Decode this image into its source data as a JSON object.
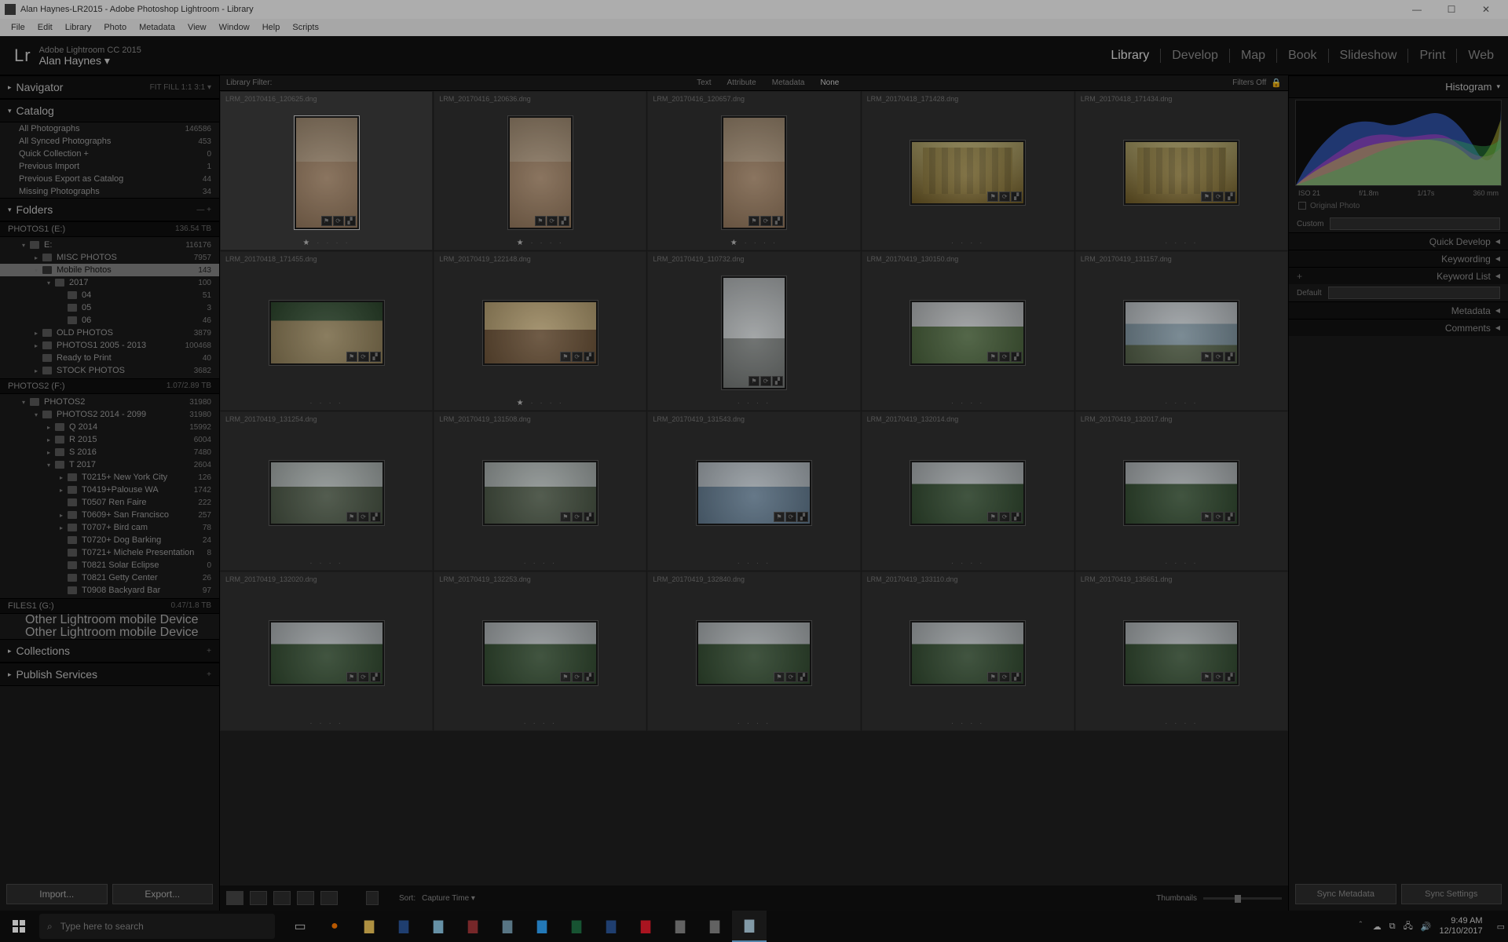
{
  "window": {
    "title": "Alan Haynes-LR2015 - Adobe Photoshop Lightroom - Library",
    "min": "—",
    "max": "☐",
    "close": "✕"
  },
  "menu": [
    "File",
    "Edit",
    "Library",
    "Photo",
    "Metadata",
    "View",
    "Window",
    "Help",
    "Scripts"
  ],
  "identity": {
    "product": "Adobe Lightroom CC 2015",
    "user": "Alan Haynes  ▾",
    "logo": "Lr"
  },
  "modules": [
    "Library",
    "Develop",
    "Map",
    "Book",
    "Slideshow",
    "Print",
    "Web"
  ],
  "active_module": "Library",
  "left": {
    "navigator": {
      "title": "Navigator",
      "extras": "FIT   FILL   1:1   3:1  ▾"
    },
    "catalog": {
      "title": "Catalog",
      "rows": [
        {
          "label": "All Photographs",
          "count": "146586"
        },
        {
          "label": "All Synced Photographs",
          "count": "453"
        },
        {
          "label": "Quick Collection  +",
          "count": "0"
        },
        {
          "label": "Previous Import",
          "count": "1"
        },
        {
          "label": "Previous Export as Catalog",
          "count": "44"
        },
        {
          "label": "Missing Photographs",
          "count": "34"
        }
      ]
    },
    "folders": {
      "title": "Folders",
      "volumes": [
        {
          "name": "PHOTOS1 (E:)",
          "info": "136.54 TB"
        }
      ],
      "tree": [
        {
          "tw": "▾",
          "d": 1,
          "label": "E:",
          "count": "116176"
        },
        {
          "tw": "▸",
          "d": 2,
          "label": "MISC PHOTOS",
          "count": "7957"
        },
        {
          "tw": "▾",
          "d": 2,
          "label": "Mobile Photos",
          "count": "143",
          "sel": true
        },
        {
          "tw": "▾",
          "d": 3,
          "label": "2017",
          "count": "100"
        },
        {
          "tw": "",
          "d": 4,
          "label": "04",
          "count": "51"
        },
        {
          "tw": "",
          "d": 4,
          "label": "05",
          "count": "3"
        },
        {
          "tw": "",
          "d": 4,
          "label": "06",
          "count": "46"
        },
        {
          "tw": "▸",
          "d": 2,
          "label": "OLD PHOTOS",
          "count": "3879"
        },
        {
          "tw": "▸",
          "d": 2,
          "label": "PHOTOS1 2005 - 2013",
          "count": "100468"
        },
        {
          "tw": "",
          "d": 2,
          "label": "Ready to Print",
          "count": "40"
        },
        {
          "tw": "▸",
          "d": 2,
          "label": "STOCK PHOTOS",
          "count": "3682"
        }
      ],
      "vol2": {
        "name": "PHOTOS2 (F:)",
        "info": "1.07/2.89 TB"
      },
      "tree2": [
        {
          "tw": "▾",
          "d": 1,
          "label": "PHOTOS2",
          "count": "31980"
        },
        {
          "tw": "▾",
          "d": 2,
          "label": "PHOTOS2 2014 - 2099",
          "count": "31980"
        },
        {
          "tw": "▸",
          "d": 3,
          "label": "Q 2014",
          "count": "15992"
        },
        {
          "tw": "▸",
          "d": 3,
          "label": "R 2015",
          "count": "6004"
        },
        {
          "tw": "▸",
          "d": 3,
          "label": "S 2016",
          "count": "7480"
        },
        {
          "tw": "▾",
          "d": 3,
          "label": "T 2017",
          "count": "2604"
        },
        {
          "tw": "▸",
          "d": 4,
          "label": "T0215+ New York City",
          "count": "126"
        },
        {
          "tw": "▸",
          "d": 4,
          "label": "T0419+Palouse WA",
          "count": "1742"
        },
        {
          "tw": "",
          "d": 4,
          "label": "T0507 Ren Faire",
          "count": "222"
        },
        {
          "tw": "▸",
          "d": 4,
          "label": "T0609+ San Francisco",
          "count": "257"
        },
        {
          "tw": "▸",
          "d": 4,
          "label": "T0707+ Bird cam",
          "count": "78"
        },
        {
          "tw": "",
          "d": 4,
          "label": "T0720+ Dog Barking",
          "count": "24"
        },
        {
          "tw": "",
          "d": 4,
          "label": "T0721+ Michele Presentation",
          "count": "8"
        },
        {
          "tw": "",
          "d": 4,
          "label": "T0821 Solar Eclipse",
          "count": "0"
        },
        {
          "tw": "",
          "d": 4,
          "label": "T0821 Getty Center",
          "count": "26"
        },
        {
          "tw": "",
          "d": 4,
          "label": "T0908 Backyard Bar",
          "count": "97"
        }
      ],
      "vol3": {
        "name": "FILES1 (G:)",
        "info": "0.47/1.8 TB"
      },
      "mobile1": "Other Lightroom mobile Device",
      "mobile2": "Other Lightroom mobile Device"
    },
    "collections": "Collections",
    "publish": "Publish Services",
    "import": "Import...",
    "export": "Export..."
  },
  "filterbar": {
    "label": "Library Filter:",
    "tabs": [
      "Text",
      "Attribute",
      "Metadata",
      "None"
    ],
    "filters_off": "Filters Off",
    "lock": "🔒"
  },
  "thumbs": [
    {
      "f": "LRM_20170416_120625.dng",
      "o": "portrait",
      "c": "ph-indoor",
      "sel": true,
      "star": 1
    },
    {
      "f": "LRM_20170416_120636.dng",
      "o": "portrait",
      "c": "ph-indoor",
      "star": 1
    },
    {
      "f": "LRM_20170416_120657.dng",
      "o": "portrait",
      "c": "ph-indoor",
      "star": 1
    },
    {
      "f": "LRM_20170418_171428.dng",
      "o": "landscape",
      "c": "ph-lobby"
    },
    {
      "f": "LRM_20170418_171434.dng",
      "o": "landscape",
      "c": "ph-lobby"
    },
    {
      "f": "LRM_20170418_171455.dng",
      "o": "landscape",
      "c": "ph-rest"
    },
    {
      "f": "LRM_20170419_122148.dng",
      "o": "landscape",
      "c": "ph-person",
      "star": 1
    },
    {
      "f": "LRM_20170419_110732.dng",
      "o": "portrait",
      "c": "ph-street"
    },
    {
      "f": "LRM_20170419_130150.dng",
      "o": "landscape",
      "c": "ph-park"
    },
    {
      "f": "LRM_20170419_131157.dng",
      "o": "landscape",
      "c": "ph-lake"
    },
    {
      "f": "LRM_20170419_131254.dng",
      "o": "landscape",
      "c": "ph-cliff"
    },
    {
      "f": "LRM_20170419_131508.dng",
      "o": "landscape",
      "c": "ph-cliff"
    },
    {
      "f": "LRM_20170419_131543.dng",
      "o": "landscape",
      "c": "ph-marina"
    },
    {
      "f": "LRM_20170419_132014.dng",
      "o": "landscape",
      "c": "ph-trees"
    },
    {
      "f": "LRM_20170419_132017.dng",
      "o": "landscape",
      "c": "ph-trees"
    },
    {
      "f": "LRM_20170419_132020.dng",
      "o": "landscape",
      "c": "ph-trees"
    },
    {
      "f": "LRM_20170419_132253.dng",
      "o": "landscape",
      "c": "ph-trees"
    },
    {
      "f": "LRM_20170419_132840.dng",
      "o": "landscape",
      "c": "ph-trees"
    },
    {
      "f": "LRM_20170419_133110.dng",
      "o": "landscape",
      "c": "ph-trees"
    },
    {
      "f": "LRM_20170419_135651.dng",
      "o": "landscape",
      "c": "ph-trees"
    }
  ],
  "toolbar": {
    "sort_label": "Sort:",
    "sort_value": "Capture Time  ▾",
    "thumb_label": "Thumbnails"
  },
  "right": {
    "histogram_title": "Histogram",
    "hist_info": [
      "ISO 21",
      "f/1.8m",
      "1/17s",
      "360 mm"
    ],
    "orig": "Original Photo",
    "panels": [
      "Quick Develop",
      "Keywording",
      "Keyword List",
      "Metadata",
      "Comments"
    ],
    "custom_label": "Custom",
    "default_label": "Default",
    "sync_meta": "Sync Metadata",
    "sync_set": "Sync Settings"
  },
  "taskbar": {
    "search_placeholder": "Type here to search",
    "time": "9:49 AM",
    "date": "12/10/2017"
  }
}
